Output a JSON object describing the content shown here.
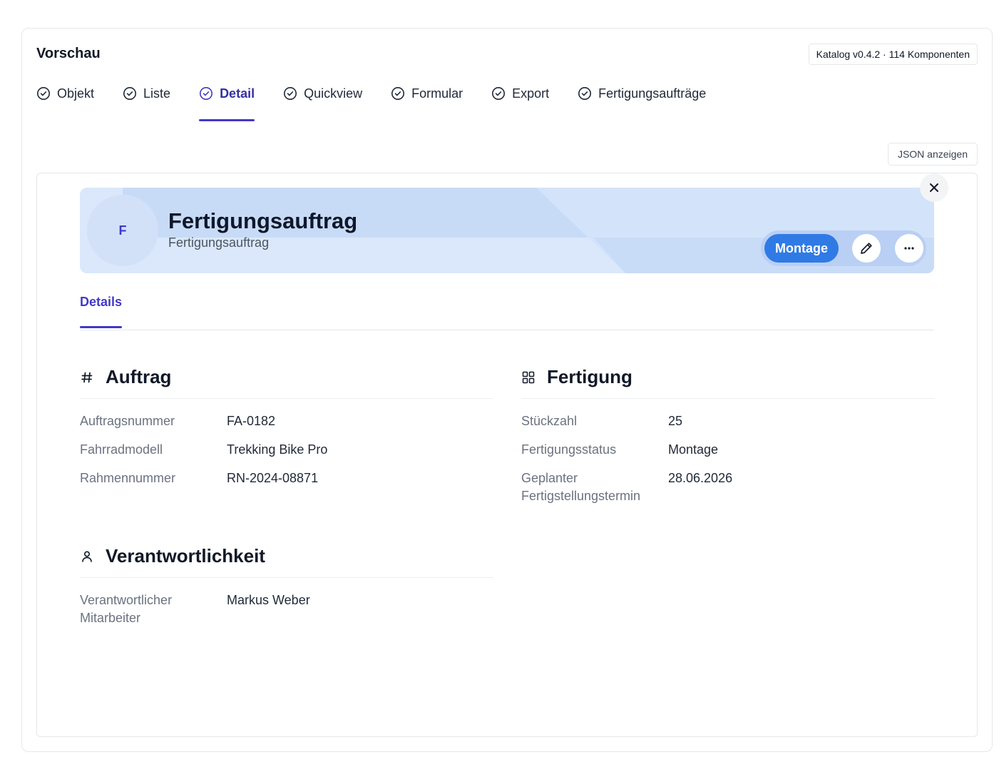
{
  "frame": {
    "title": "Vorschau",
    "catalog_badge": "Katalog v0.4.2 · 114 Komponenten"
  },
  "tabs": [
    {
      "label": "Objekt",
      "active": false
    },
    {
      "label": "Liste",
      "active": false
    },
    {
      "label": "Detail",
      "active": true
    },
    {
      "label": "Quickview",
      "active": false
    },
    {
      "label": "Formular",
      "active": false
    },
    {
      "label": "Export",
      "active": false
    },
    {
      "label": "Fertigungsaufträge",
      "active": false
    }
  ],
  "json_button": "JSON anzeigen",
  "hero": {
    "avatar_letter": "F",
    "title": "Fertigungsauftrag",
    "subtitle": "Fertigungsauftrag",
    "status": "Montage",
    "edit_icon": "pencil-icon",
    "more_icon": "more-horizontal-icon",
    "close_icon": "close-icon"
  },
  "subtabs": [
    {
      "label": "Details",
      "active": true
    }
  ],
  "sections": {
    "auftrag": {
      "title": "Auftrag",
      "icon": "hash-icon",
      "rows": [
        {
          "label": "Auftragsnummer",
          "value": "FA-0182"
        },
        {
          "label": "Fahrradmodell",
          "value": "Trekking Bike Pro"
        },
        {
          "label": "Rahmennummer",
          "value": "RN-2024-08871"
        }
      ]
    },
    "fertigung": {
      "title": "Fertigung",
      "icon": "grid-icon",
      "rows": [
        {
          "label": "Stückzahl",
          "value": "25"
        },
        {
          "label": "Fertigungsstatus",
          "value": "Montage"
        },
        {
          "label": "Geplanter Fertigstellungstermin",
          "value": "28.06.2026"
        }
      ]
    },
    "verantwortlichkeit": {
      "title": "Verantwortlichkeit",
      "icon": "user-icon",
      "rows": [
        {
          "label": "Verantwortlicher Mitarbeiter",
          "value": "Markus Weber"
        }
      ]
    }
  },
  "colors": {
    "accent": "#4338ca",
    "status_badge": "#2f7ae5",
    "hero_bg": "#dbe8fb"
  }
}
